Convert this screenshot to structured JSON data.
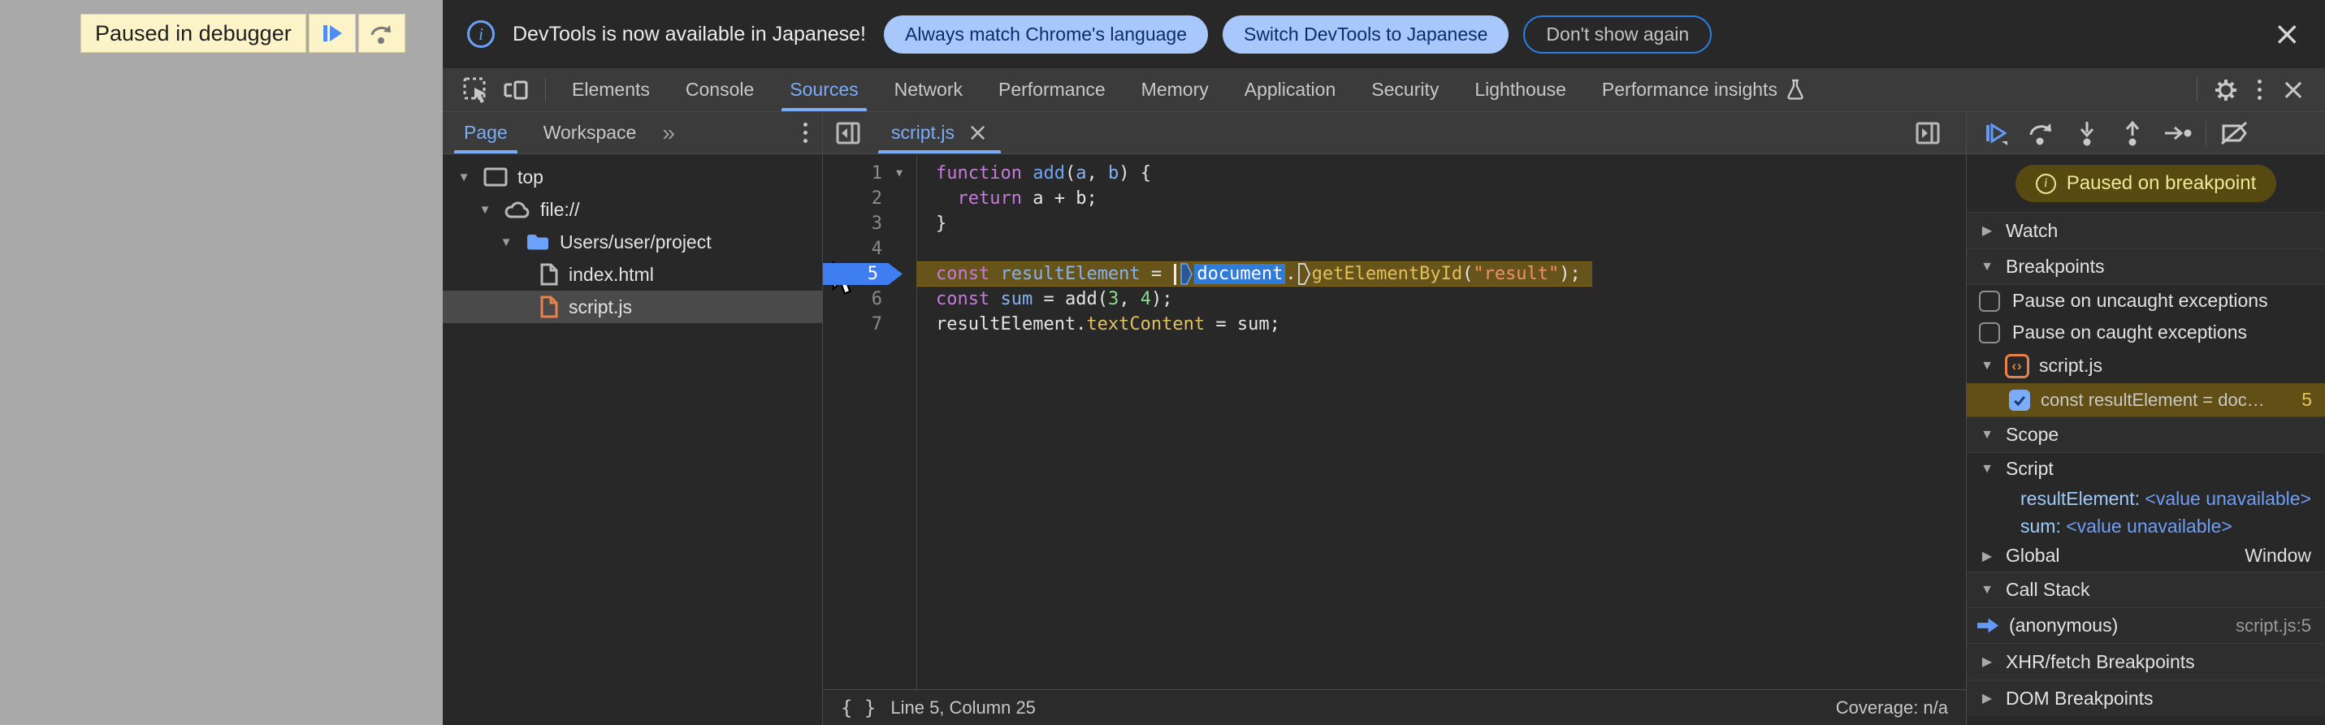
{
  "page_overlay": {
    "paused_label": "Paused in debugger",
    "icons": {
      "resume": "bar-plus-play-triangle",
      "step_over": "curved-arrow-over-dot"
    }
  },
  "notification": {
    "message": "DevTools is now available in Japanese!",
    "buttons": [
      {
        "label": "Always match Chrome's language",
        "style": "filled"
      },
      {
        "label": "Switch DevTools to Japanese",
        "style": "filled"
      },
      {
        "label": "Don't show again",
        "style": "outline"
      }
    ],
    "close_symbol": "×"
  },
  "main_tabs": {
    "items": [
      "Elements",
      "Console",
      "Sources",
      "Network",
      "Performance",
      "Memory",
      "Application",
      "Security",
      "Lighthouse",
      "Performance insights"
    ],
    "selected": "Sources",
    "flask_on": "Performance insights"
  },
  "navigator": {
    "tabs": [
      {
        "label": "Page",
        "selected": true
      },
      {
        "label": "Workspace",
        "selected": false
      }
    ],
    "more_symbol": "»",
    "tree": [
      {
        "label": "top",
        "icon": "frame-icon",
        "expanded": true,
        "depth": 0
      },
      {
        "label": "file://",
        "icon": "cloud-icon",
        "expanded": true,
        "depth": 1
      },
      {
        "label": "Users/user/project",
        "icon": "folder-icon",
        "expanded": true,
        "depth": 2
      },
      {
        "label": "index.html",
        "icon": "file-icon",
        "depth": 3
      },
      {
        "label": "script.js",
        "icon": "file-icon-orange",
        "depth": 3,
        "selected": true
      }
    ]
  },
  "editor": {
    "tab_label": "script.js",
    "tab_close_symbol": "×",
    "status_position": "Line 5, Column 25",
    "status_coverage": "Coverage: n/a",
    "lines": [
      {
        "n": "1",
        "fold": true,
        "tokens": [
          [
            "kw",
            "function"
          ],
          [
            "pl",
            " "
          ],
          [
            "fn",
            "add"
          ],
          [
            "pl",
            "("
          ],
          [
            "vr",
            "a"
          ],
          [
            "pl",
            ", "
          ],
          [
            "vr",
            "b"
          ],
          [
            "pl",
            ") {"
          ]
        ]
      },
      {
        "n": "2",
        "tokens": [
          [
            "pl",
            "  "
          ],
          [
            "kw",
            "return"
          ],
          [
            "pl",
            " a + b;"
          ]
        ]
      },
      {
        "n": "3",
        "tokens": [
          [
            "pl",
            "}"
          ]
        ]
      },
      {
        "n": "4",
        "tokens": []
      },
      {
        "n": "5",
        "exec": true,
        "tokens": [
          [
            "kw",
            "const"
          ],
          [
            "pl",
            " "
          ],
          [
            "vr",
            "resultElement"
          ],
          [
            "pl",
            " = "
          ],
          [
            "caret",
            ""
          ],
          [
            "m1",
            ""
          ],
          [
            "sel",
            "document"
          ],
          [
            "pl",
            "."
          ],
          [
            "m2",
            ""
          ],
          [
            "prop",
            "getElementById"
          ],
          [
            "pl",
            "("
          ],
          [
            "str",
            "\"result\""
          ],
          [
            "pl",
            ");"
          ]
        ]
      },
      {
        "n": "6",
        "tokens": [
          [
            "kw",
            "const"
          ],
          [
            "pl",
            " "
          ],
          [
            "vr",
            "sum"
          ],
          [
            "pl",
            " = add("
          ],
          [
            "num",
            "3"
          ],
          [
            "pl",
            ", "
          ],
          [
            "num",
            "4"
          ],
          [
            "pl",
            ");"
          ]
        ]
      },
      {
        "n": "7",
        "tokens": [
          [
            "pl",
            "resultElement."
          ],
          [
            "prop",
            "textContent"
          ],
          [
            "pl",
            " = sum;"
          ]
        ]
      }
    ]
  },
  "debugger": {
    "toolbar_icons": [
      "resume-icon",
      "step-over-icon",
      "step-into-icon",
      "step-out-icon",
      "step-icon",
      "deactivate-breakpoints-icon"
    ],
    "paused_badge": "Paused on breakpoint",
    "watch_label": "Watch",
    "breakpoints_label": "Breakpoints",
    "opt_uncaught": "Pause on uncaught exceptions",
    "opt_caught": "Pause on caught exceptions",
    "breakpoint_group_file": "script.js",
    "breakpoint_entry_label": "const resultElement = doc…",
    "breakpoint_entry_line": "5",
    "scope_label": "Scope",
    "scope_script_label": "Script",
    "scope_vars": [
      {
        "name": "resultElement",
        "value": "<value unavailable>"
      },
      {
        "name": "sum",
        "value": "<value unavailable>"
      }
    ],
    "global_label": "Global",
    "global_value": "Window",
    "call_stack_label": "Call Stack",
    "frame_name": "(anonymous)",
    "frame_location": "script.js:5",
    "xhr_label": "XHR/fetch Breakpoints",
    "dom_label": "DOM Breakpoints"
  },
  "colors": {
    "accent_blue": "#7cacf8",
    "selection_blue": "#2f7bd9",
    "pill_bg": "#a8c7fa",
    "pill_text": "#0a2d6e",
    "exec_line_bg": "#66541a",
    "paused_badge_bg": "#574a11",
    "paused_badge_text": "#f2e597",
    "keyword_purple": "#c57bdb",
    "property_yellow": "#e2c05c",
    "string_orange": "#ef9066",
    "number_green": "#8fdb90",
    "file_orange": "#e8824a",
    "toolbar_bg": "#3b3b3b",
    "panel_bg": "#282828",
    "page_gray": "#a9a9a9",
    "overlay_yellow": "#fcf4c8"
  }
}
